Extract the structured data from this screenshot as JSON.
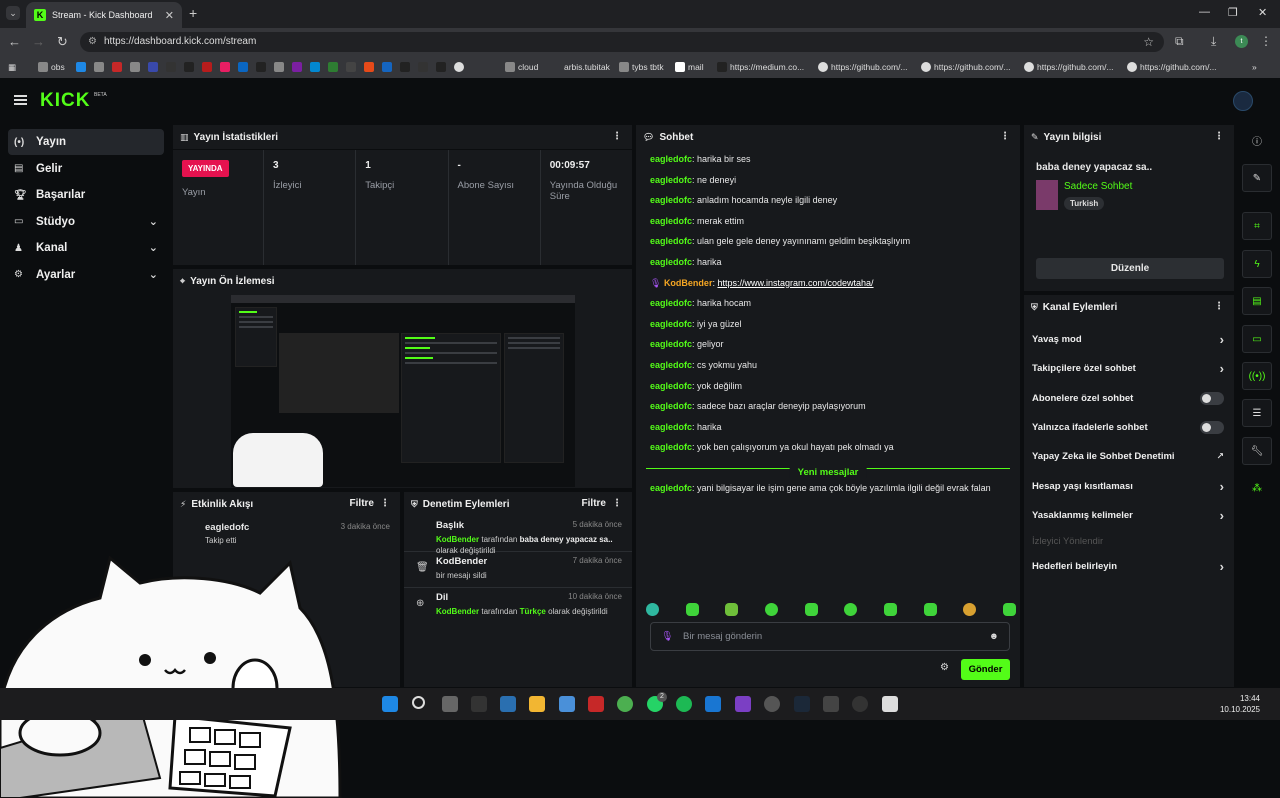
{
  "browser": {
    "tab_title": "Stream - Kick Dashboard",
    "url": "https://dashboard.kick.com/stream",
    "bookmarks": [
      "obs",
      "cloud",
      "arbis.tubitak",
      "tybs tbtk",
      "mail",
      "https://medium.co...",
      "https://github.com/...",
      "https://github.com/...",
      "https://github.com/...",
      "https://github.com/..."
    ]
  },
  "app": {
    "logo": "KICK",
    "beta": "BETA"
  },
  "sidebar": {
    "items": [
      {
        "label": "Yayın",
        "icon": "broadcast-icon"
      },
      {
        "label": "Gelir",
        "icon": "income-icon"
      },
      {
        "label": "Başarılar",
        "icon": "trophy-icon"
      },
      {
        "label": "Stüdyo",
        "icon": "studio-icon"
      },
      {
        "label": "Kanal",
        "icon": "channel-icon"
      },
      {
        "label": "Ayarlar",
        "icon": "settings-icon"
      }
    ]
  },
  "stats": {
    "title": "Yayın İstatistikleri",
    "live_badge": "YAYINDA",
    "items": [
      {
        "value": "",
        "label": "Yayın"
      },
      {
        "value": "3",
        "label": "İzleyici"
      },
      {
        "value": "1",
        "label": "Takipçi"
      },
      {
        "value": "-",
        "label": "Abone Sayısı"
      },
      {
        "value": "00:09:57",
        "label": "Yayında Olduğu Süre"
      }
    ]
  },
  "preview": {
    "title": "Yayın Ön İzlemesi"
  },
  "activity": {
    "title": "Etkinlik Akışı",
    "filter": "Filtre",
    "items": [
      {
        "user": "eagledofc",
        "time": "3 dakika önce",
        "desc": "Takip etti"
      }
    ]
  },
  "moderation": {
    "title": "Denetim Eylemleri",
    "filter": "Filtre",
    "items": [
      {
        "title": "Başlık",
        "time": "5 dakika önce",
        "by": "KodBender",
        "mid": " tarafından ",
        "what": "baba deney yapacaz sa..",
        "end": " olarak değiştirildi"
      },
      {
        "title": "KodBender",
        "time": "7 dakika önce",
        "by": "",
        "mid": "",
        "what": "",
        "end": "bir mesajı sildi"
      },
      {
        "title": "Dil",
        "time": "10 dakika önce",
        "by": "KodBender",
        "mid": " tarafından ",
        "what": "Türkçe",
        "end": " olarak değiştirildi"
      }
    ]
  },
  "chat": {
    "title": "Sohbet",
    "messages": [
      {
        "user": "eagledofc",
        "text": "harika bir ses"
      },
      {
        "user": "eagledofc",
        "text": "ne deneyi"
      },
      {
        "user": "eagledofc",
        "text": "anladım hocamda neyle ilgili deney"
      },
      {
        "user": "eagledofc",
        "text": "merak ettim"
      },
      {
        "user": "eagledofc",
        "text": "ulan gele gele deney yayınınamı geldim beşiktaşlıyım"
      },
      {
        "user": "eagledofc",
        "text": "harika"
      },
      {
        "user": "KodBender",
        "text": "https://www.instagram.com/codewtaha/"
      },
      {
        "user": "eagledofc",
        "text": "harika hocam"
      },
      {
        "user": "eagledofc",
        "text": "iyi ya güzel"
      },
      {
        "user": "eagledofc",
        "text": "geliyor"
      },
      {
        "user": "eagledofc",
        "text": "cs yokmu yahu"
      },
      {
        "user": "eagledofc",
        "text": "yok değilim"
      },
      {
        "user": "eagledofc",
        "text": "sadece bazı araçlar deneyip paylaşıyorum"
      },
      {
        "user": "eagledofc",
        "text": "harika"
      },
      {
        "user": "eagledofc",
        "text": "yok ben çalışıyorum ya okul hayatı pek olmadı ya"
      }
    ],
    "new_messages": "Yeni mesajlar",
    "after": [
      {
        "user": "eagledofc",
        "text": "yani bilgisayar ile işim gene ama çok böyle yazılımla ilgili değil evrak falan"
      }
    ],
    "input_placeholder": "Bir mesaj gönderin",
    "send": "Gönder"
  },
  "stream_info": {
    "title": "Yayın bilgisi",
    "stream_title": "baba deney yapacaz sa..",
    "category": "Sadece Sohbet",
    "language": "Turkish",
    "edit": "Düzenle"
  },
  "channel_actions": {
    "title": "Kanal Eylemleri",
    "items": [
      {
        "label": "Yavaş mod",
        "type": "chevron"
      },
      {
        "label": "Takipçilere özel sohbet",
        "type": "chevron"
      },
      {
        "label": "Abonelere özel sohbet",
        "type": "toggle"
      },
      {
        "label": "Yalnızca ifadelerle sohbet",
        "type": "toggle"
      },
      {
        "label": "Yapay Zeka ile Sohbet Denetimi",
        "type": "external"
      },
      {
        "label": "Hesap yaşı kısıtlaması",
        "type": "chevron"
      },
      {
        "label": "Yasaklanmış kelimeler",
        "type": "chevron"
      },
      {
        "label": "İzleyici Yönlendir",
        "type": "dim"
      },
      {
        "label": "Hedefleri belirleyin",
        "type": "chevron"
      }
    ]
  },
  "taskbar": {
    "time": "13:44",
    "date": "10.10.2025",
    "badge": "2"
  }
}
